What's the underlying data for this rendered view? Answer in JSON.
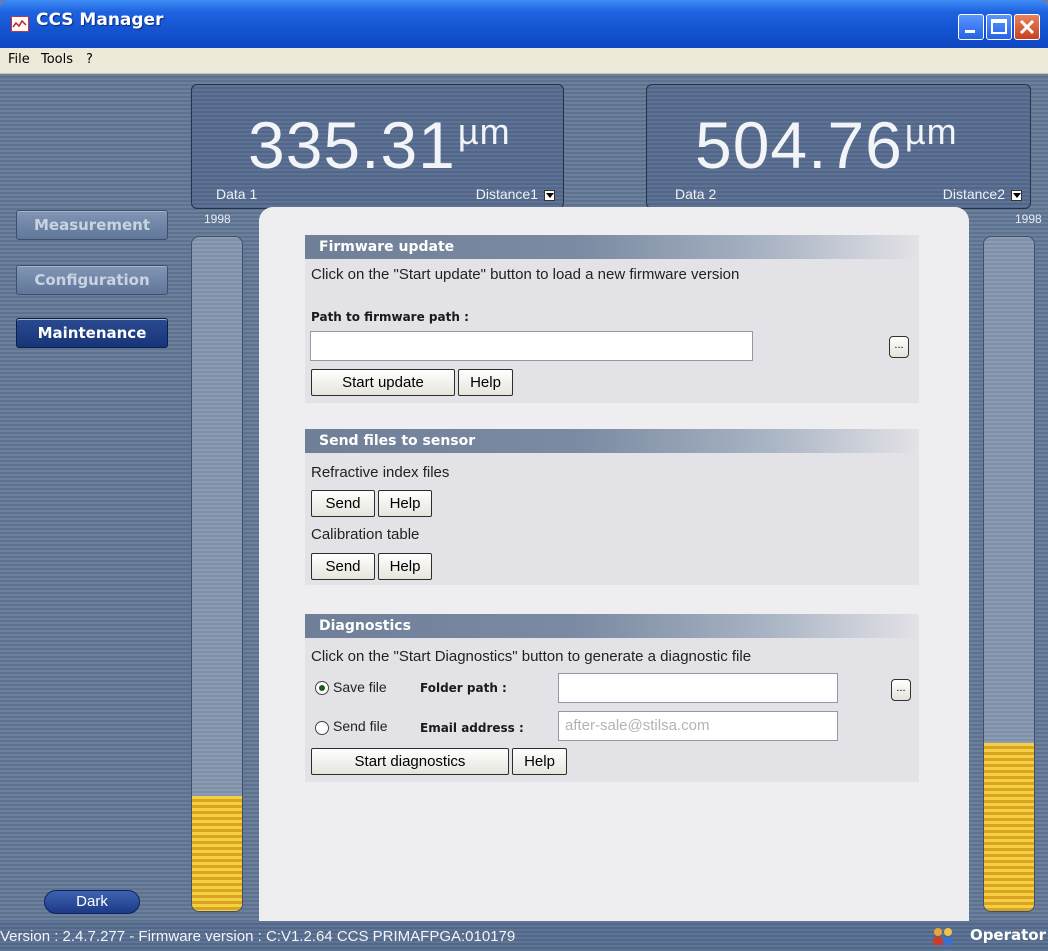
{
  "window": {
    "title": "CCS Manager"
  },
  "menu": {
    "items": [
      "File",
      "Tools",
      "?"
    ]
  },
  "displays": [
    {
      "value": "335.31",
      "unit": "µm",
      "label": "Data 1",
      "channel": "Distance1"
    },
    {
      "value": "504.76",
      "unit": "µm",
      "label": "Data 2",
      "channel": "Distance2"
    }
  ],
  "nav": {
    "measurement": "Measurement",
    "configuration": "Configuration",
    "maintenance": "Maintenance",
    "active": "Maintenance"
  },
  "bars": {
    "left": {
      "label": "1998",
      "level": 0.17
    },
    "right": {
      "label": "1998",
      "level": 0.25
    }
  },
  "dark_button": "Dark",
  "firmware": {
    "title": "Firmware update",
    "description": "Click on the \"Start update\" button to load a new firmware version",
    "path_label": "Path to firmware path :",
    "path_value": "",
    "browse": "...",
    "start": "Start update",
    "help": "Help"
  },
  "send_files": {
    "title": "Send files to sensor",
    "refractive_label": "Refractive index files",
    "calibration_label": "Calibration table",
    "send": "Send",
    "help": "Help"
  },
  "diagnostics": {
    "title": "Diagnostics",
    "description": "Click on the \"Start Diagnostics\" button to generate a diagnostic file",
    "save_file": "Save file",
    "send_file": "Send file",
    "folder_label": "Folder path :",
    "folder_value": "",
    "email_label": "Email address :",
    "email_placeholder": "after-sale@stilsa.com",
    "selected": "Save file",
    "browse": "...",
    "start": "Start diagnostics",
    "help": "Help"
  },
  "status": {
    "version": "Version : 2.4.7.277 - Firmware version : C:V1.2.64 CCS PRIMAFPGA:010179",
    "role": "Operator"
  },
  "colors": {
    "title_bar": "#1f62e0",
    "accent_fill": "#f6d042",
    "nav_active": "#1f3f86"
  }
}
